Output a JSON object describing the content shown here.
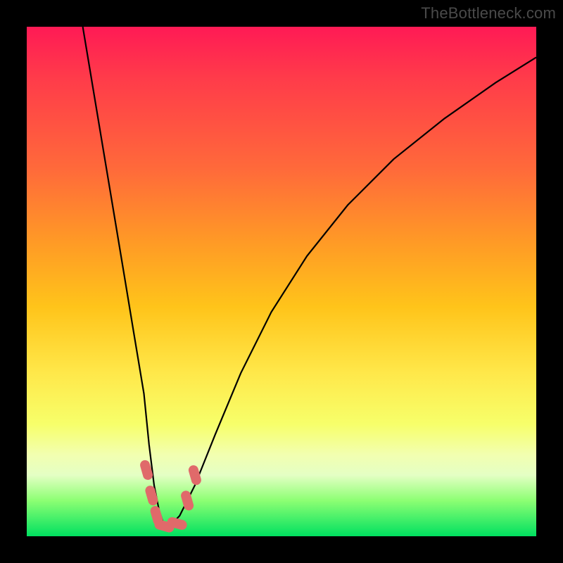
{
  "watermark": "TheBottleneck.com",
  "chart_data": {
    "type": "line",
    "title": "",
    "xlabel": "",
    "ylabel": "",
    "xlim": [
      0,
      100
    ],
    "ylim": [
      0,
      100
    ],
    "series": [
      {
        "name": "bottleneck-curve",
        "x": [
          11,
          13,
          15,
          17,
          19,
          21,
          23,
          24,
          25,
          26,
          27,
          28,
          30,
          33,
          37,
          42,
          48,
          55,
          63,
          72,
          82,
          92,
          100
        ],
        "values": [
          100,
          88,
          76,
          64,
          52,
          40,
          28,
          18,
          10,
          5,
          2,
          2,
          4,
          10,
          20,
          32,
          44,
          55,
          65,
          74,
          82,
          89,
          94
        ]
      }
    ],
    "markers": [
      {
        "name": "marker-left-1",
        "x": 23.5,
        "y": 13,
        "color": "#e06a6a"
      },
      {
        "name": "marker-left-2",
        "x": 24.5,
        "y": 8,
        "color": "#e06a6a"
      },
      {
        "name": "marker-left-3",
        "x": 25.5,
        "y": 4,
        "color": "#e06a6a"
      },
      {
        "name": "marker-bottom-1",
        "x": 27.0,
        "y": 2,
        "color": "#e06a6a"
      },
      {
        "name": "marker-bottom-2",
        "x": 29.5,
        "y": 2.5,
        "color": "#e06a6a"
      },
      {
        "name": "marker-right-1",
        "x": 31.5,
        "y": 7,
        "color": "#e06a6a"
      },
      {
        "name": "marker-right-2",
        "x": 33.0,
        "y": 12,
        "color": "#e06a6a"
      }
    ],
    "colors": {
      "curve": "#000000",
      "marker": "#e06a6a",
      "background_top": "#ff1a55",
      "background_bottom": "#00e060",
      "frame": "#000000"
    }
  }
}
